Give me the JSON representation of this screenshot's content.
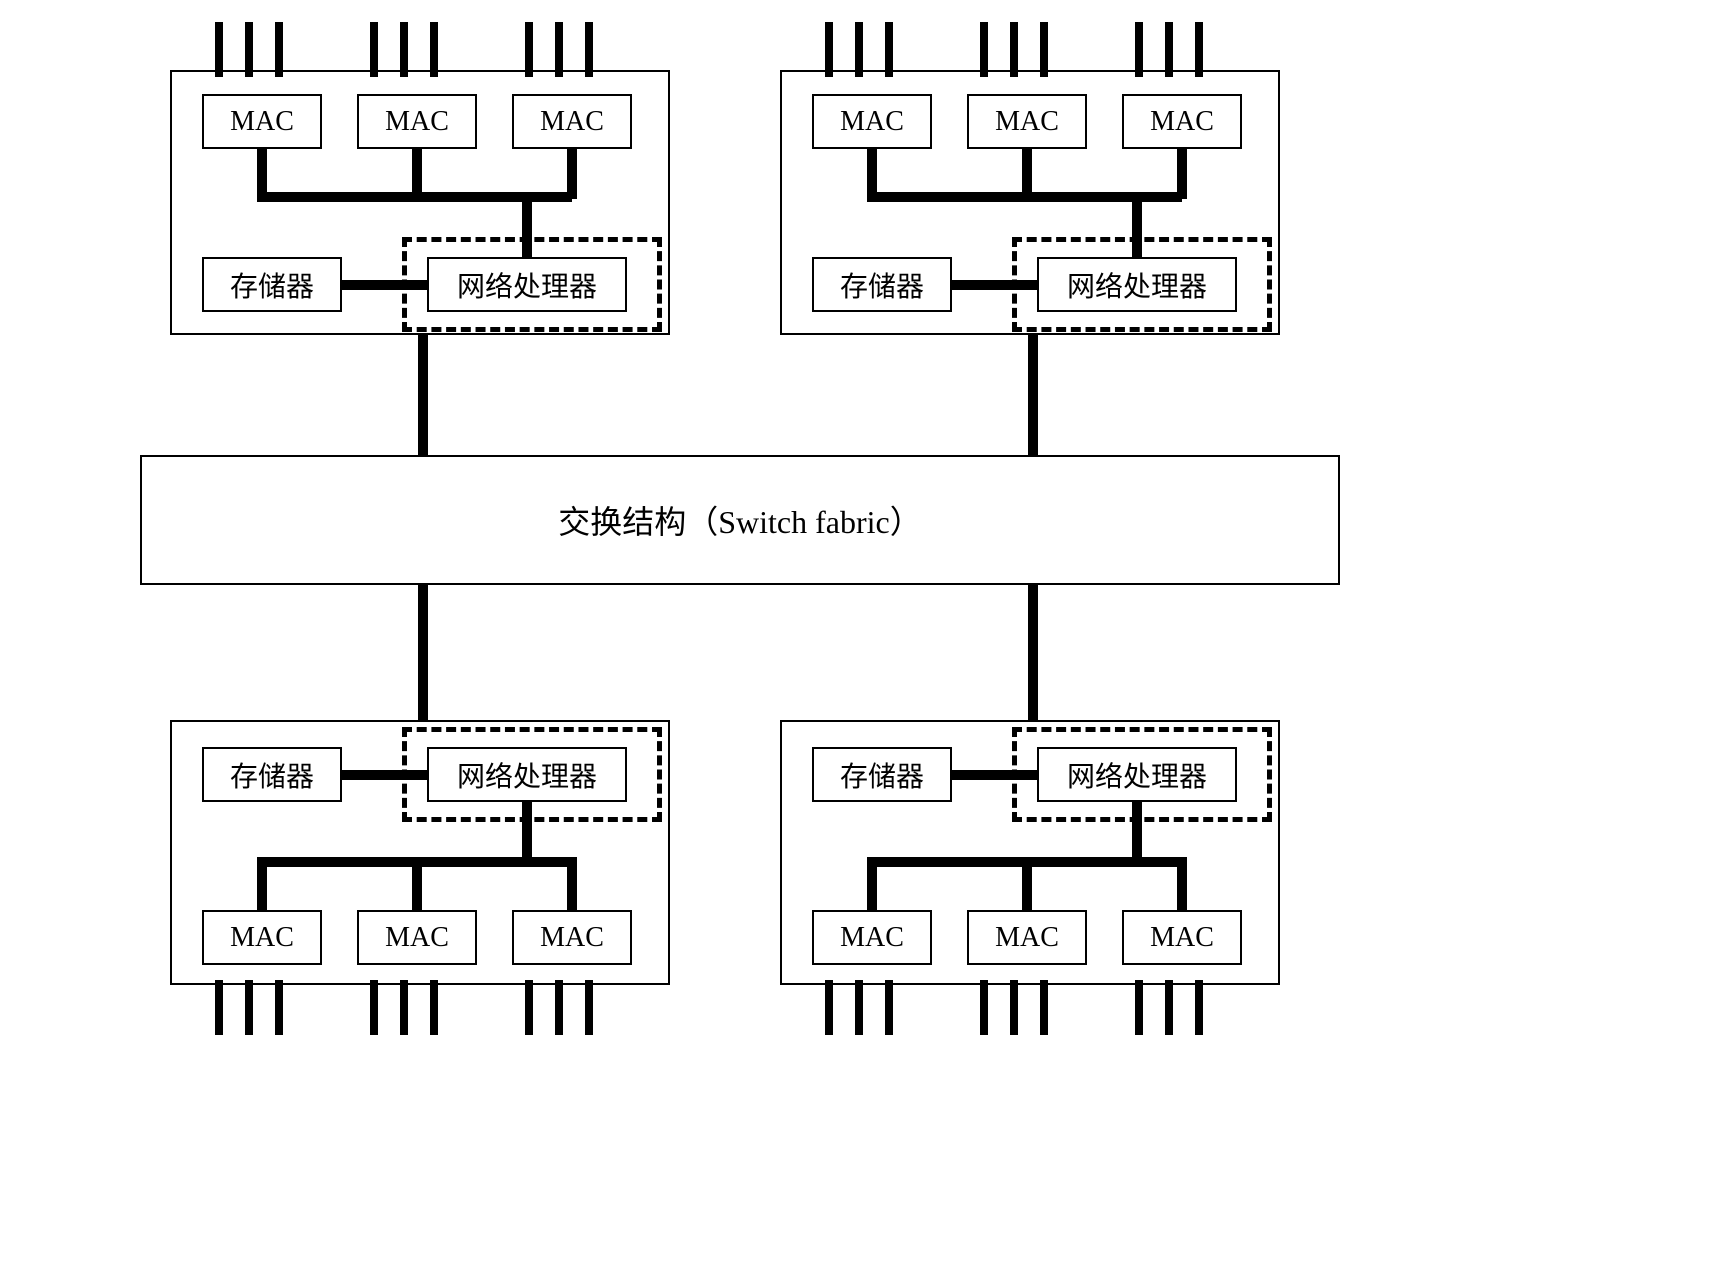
{
  "labels": {
    "mac": "MAC",
    "memory": "存储器",
    "network_processor": "网络处理器",
    "switch_fabric": "交换结构（Switch fabric）"
  },
  "cards": {
    "top_left": {
      "macs": [
        "MAC",
        "MAC",
        "MAC"
      ],
      "memory": "存储器",
      "np": "网络处理器"
    },
    "top_right": {
      "macs": [
        "MAC",
        "MAC",
        "MAC"
      ],
      "memory": "存储器",
      "np": "网络处理器"
    },
    "bottom_left": {
      "macs": [
        "MAC",
        "MAC",
        "MAC"
      ],
      "memory": "存储器",
      "np": "网络处理器"
    },
    "bottom_right": {
      "macs": [
        "MAC",
        "MAC",
        "MAC"
      ],
      "memory": "存储器",
      "np": "网络处理器"
    }
  },
  "center": {
    "label": "交换结构（Switch fabric）"
  }
}
